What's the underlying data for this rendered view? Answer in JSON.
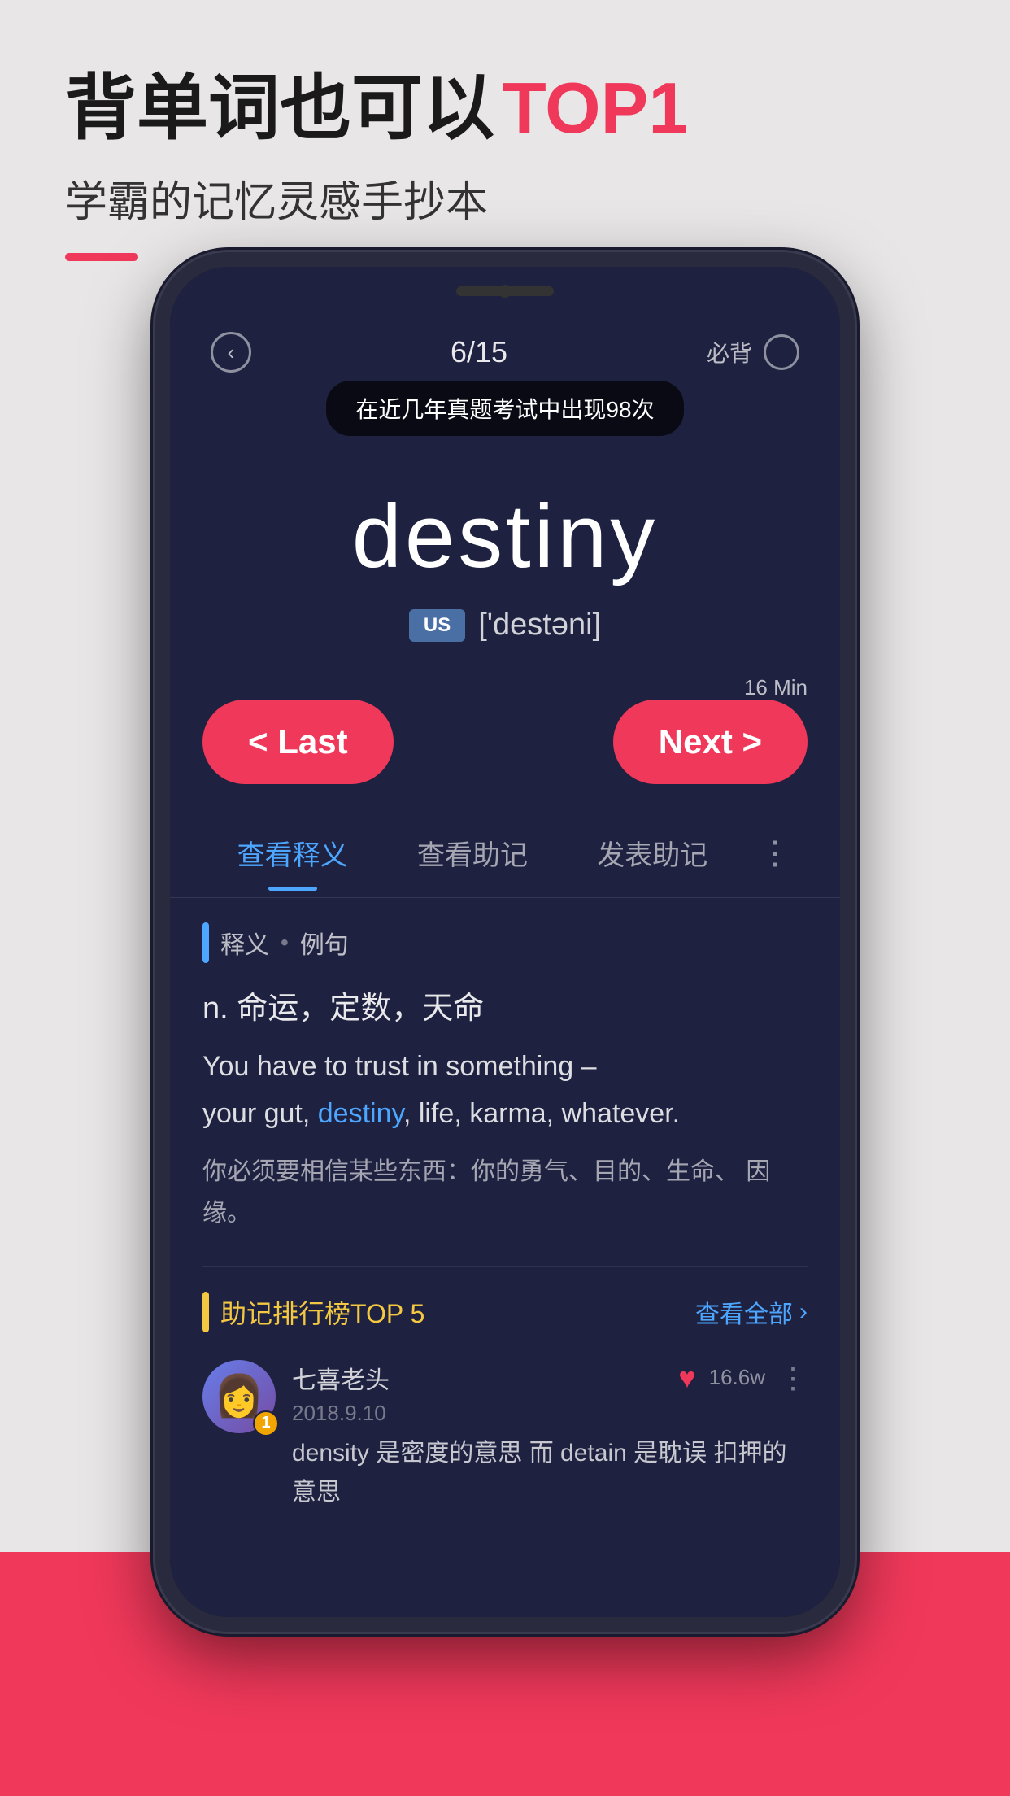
{
  "page": {
    "background_color": "#e5e3e3",
    "headline": {
      "prefix": "背单词也可以",
      "suffix": "TOP1"
    },
    "subheadline": "学霸的记忆灵感手抄本",
    "red_line": true
  },
  "phone": {
    "status": {
      "counter": "6/15",
      "must_label": "必背"
    },
    "tooltip": "在近几年真题考试中出现98次",
    "word": {
      "main": "destiny",
      "pronunciation_label": "US",
      "phonetic": "['destəni]"
    },
    "nav": {
      "time_label": "16 Min",
      "last_btn": "< Last",
      "next_btn": "Next >"
    },
    "tabs": [
      {
        "label": "查看释义",
        "active": true
      },
      {
        "label": "查看助记",
        "active": false
      },
      {
        "label": "发表助记",
        "active": false
      }
    ],
    "tab_more": "⋮",
    "content": {
      "section_label": "释义",
      "section_sublabel": "例句",
      "definition": "n.  命运，定数，天命",
      "example_en_parts": [
        {
          "text": "You have to trust in something –\nyour gut, ",
          "highlight": false
        },
        {
          "text": "destiny",
          "highlight": true
        },
        {
          "text": ", life, karma, whatever.",
          "highlight": false
        }
      ],
      "example_zh": "你必须要相信某些东西：你的勇气、目的、生命、\n因缘。"
    },
    "memory": {
      "title": "助记排行榜",
      "title_suffix": "TOP 5",
      "view_all": "查看全部",
      "items": [
        {
          "rank": "1",
          "username": "七喜老头",
          "date": "2018.9.10",
          "like_count": "16.6w",
          "text": "density 是密度的意思  而 detain 是耽误\n扣押的意思"
        }
      ]
    }
  }
}
